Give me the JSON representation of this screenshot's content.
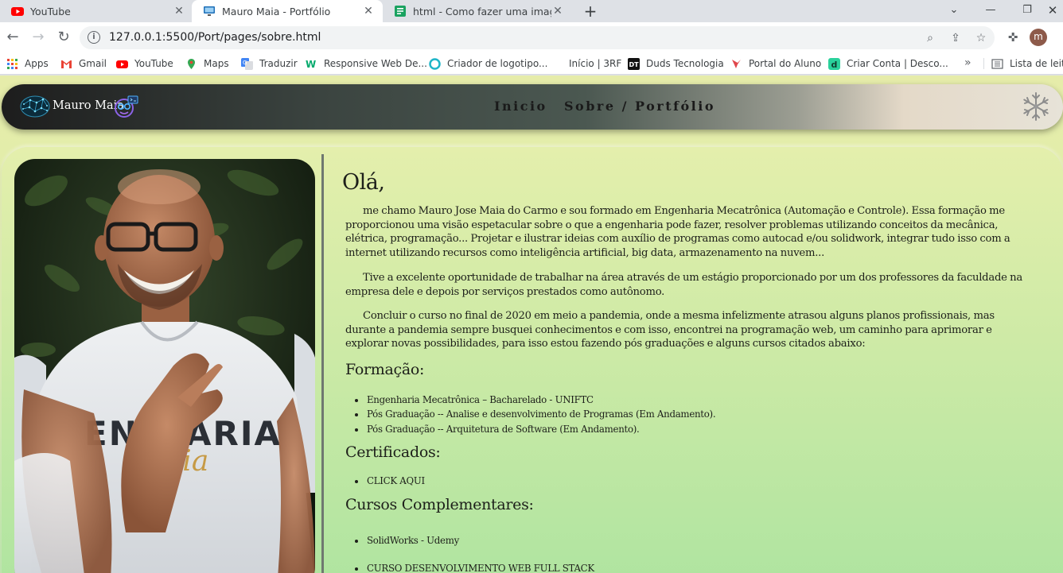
{
  "browser": {
    "tabs": [
      {
        "title": "YouTube",
        "icon": "youtube-icon",
        "active": false
      },
      {
        "title": "Mauro Maia - Portfólio",
        "icon": "monitor-icon",
        "active": true
      },
      {
        "title": "html - Como fazer uma imagem ...",
        "icon": "stackoverflow-icon",
        "active": false
      }
    ],
    "url": "127.0.0.1:5500/Port/pages/sobre.html",
    "profile_initial": "m",
    "bookmarks": [
      {
        "label": "Apps",
        "icon": "apps-grid-icon"
      },
      {
        "label": "Gmail",
        "icon": "gmail-icon"
      },
      {
        "label": "YouTube",
        "icon": "youtube-icon"
      },
      {
        "label": "Maps",
        "icon": "maps-icon"
      },
      {
        "label": "Traduzir",
        "icon": "translate-icon"
      },
      {
        "label": "Responsive Web De...",
        "icon": "w3-icon"
      },
      {
        "label": "Criador de logotipo...",
        "icon": "logo-maker-icon"
      },
      {
        "label": "Início | 3RF",
        "icon": ""
      },
      {
        "label": "Duds Tecnologia",
        "icon": "duds-icon"
      },
      {
        "label": "Portal do Aluno",
        "icon": "portal-icon"
      },
      {
        "label": "Criar Conta | Desco...",
        "icon": "discord-d-icon"
      }
    ],
    "reading_list": "Lista de leitu"
  },
  "site": {
    "brand": "Mauro Maia",
    "nav": [
      "Inicio",
      "Sobre / Portfólio"
    ]
  },
  "about": {
    "greeting": "Olá,",
    "paragraphs": [
      "me chamo Mauro Jose Maia do Carmo e sou formado em Engenharia Mecatrônica (Automação e Controle). Essa formação me proporcionou uma visão espetacular sobre o que a engenharia pode fazer, resolver problemas utilizando conceitos da mecânica, elétrica, programação... Projetar e ilustrar ideias com auxílio de programas como autocad e/ou solidwork, integrar tudo isso com a internet utilizando recursos como inteligência artificial, big data, armazenamento na nuvem...",
      "Tive a excelente oportunidade de trabalhar na área através de um estágio proporcionado por um dos professores da faculdade na empresa dele e depois por serviços prestados como autônomo.",
      "Concluir o curso no final de 2020 em meio a pandemia, onde a mesma infelizmente atrasou alguns planos profissionais, mas durante a pandemia sempre busquei conhecimentos e com isso, encontrei na programação web, um caminho para aprimorar e explorar novas possibilidades, para isso estou fazendo pós graduações e alguns cursos citados abaixo:"
    ],
    "formacao_title": "Formação:",
    "formacao": [
      "Engenharia Mecatrônica – Bacharelado - UNIFTC",
      "Pós Graduação -- Analise e desenvolvimento de Programas (Em Andamento).",
      "Pós Graduação -- Arquitetura de Software (Em Andamento)."
    ],
    "certificados_title": "Certificados:",
    "certificados": [
      "CLICK AQUI"
    ],
    "cursos_title": "Cursos Complementares:",
    "cursos": [
      "SolidWorks - Udemy",
      "CURSO DESENVOLVIMENTO WEB FULL STACK"
    ]
  }
}
